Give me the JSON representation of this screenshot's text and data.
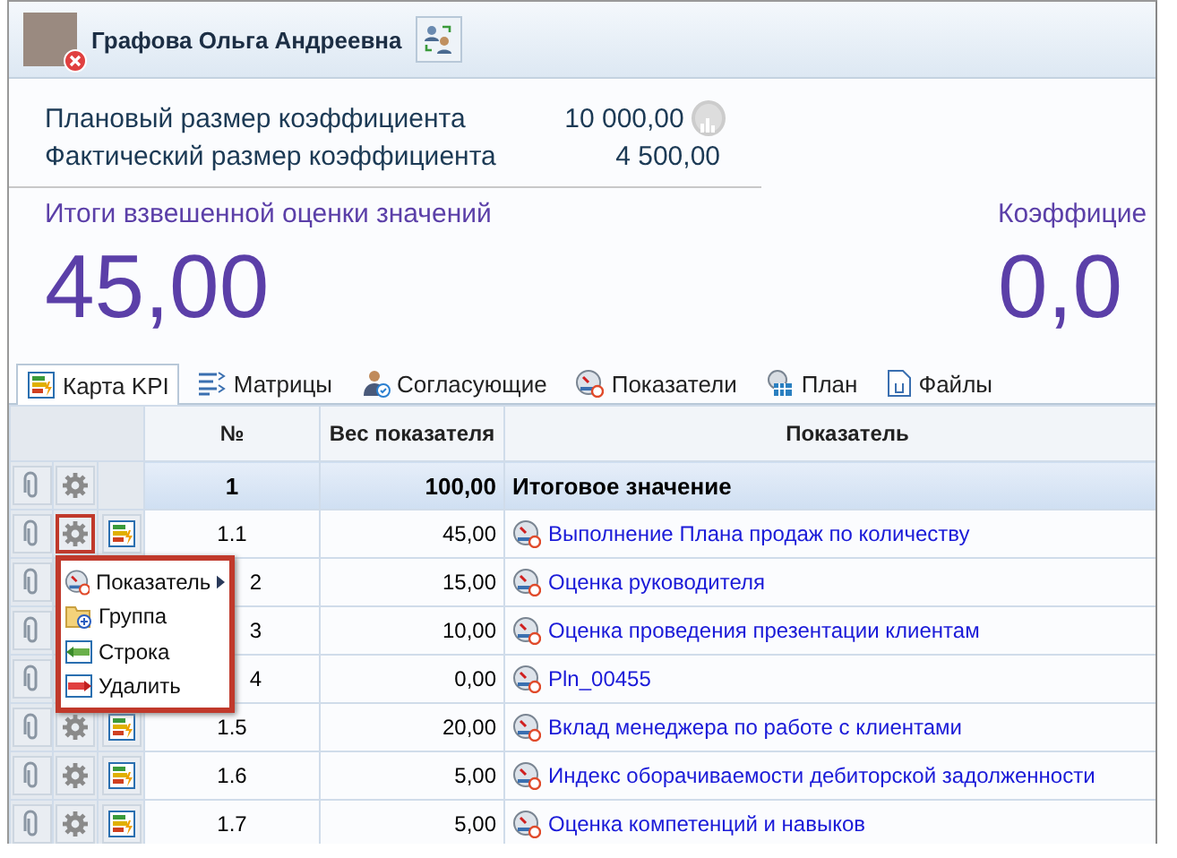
{
  "user": {
    "name": "Графова Ольга Андреевна"
  },
  "summary": [
    {
      "label": "Плановый размер коэффициента",
      "value": "10 000,00",
      "chart_button": true
    },
    {
      "label": "Фактический размер коэффициента",
      "value": "4 500,00",
      "chart_button": false
    }
  ],
  "totals": [
    {
      "label": "Итоги взвешенной оценки значений",
      "value": "45,00"
    },
    {
      "label": "Коэффицие",
      "value": "0,0"
    }
  ],
  "tabs": [
    {
      "label": "Карта KPI",
      "kind": "map",
      "selected": true
    },
    {
      "label": "Матрицы",
      "kind": "matrix",
      "selected": false
    },
    {
      "label": "Согласующие",
      "kind": "approvers",
      "selected": false
    },
    {
      "label": "Показатели",
      "kind": "gauge",
      "selected": false
    },
    {
      "label": "План",
      "kind": "plan",
      "selected": false
    },
    {
      "label": "Файлы",
      "kind": "files",
      "selected": false
    }
  ],
  "table": {
    "columns": [
      "№",
      "Вес показателя",
      "Показатель"
    ],
    "rows": [
      {
        "kind": "total",
        "number": "1",
        "weight": "100,00",
        "name": "Итоговое значение",
        "menu_open": false,
        "partly_hidden": false
      },
      {
        "kind": "item",
        "number": "1.1",
        "weight": "45,00",
        "name": "Выполнение Плана продаж по количеству",
        "menu_open": true,
        "partly_hidden": false
      },
      {
        "kind": "item",
        "number": "2",
        "weight": "15,00",
        "name": "Оценка руководителя",
        "menu_open": false,
        "partly_hidden": true
      },
      {
        "kind": "item",
        "number": "3",
        "weight": "10,00",
        "name": "Оценка проведения презентации клиентам",
        "menu_open": false,
        "partly_hidden": true
      },
      {
        "kind": "item",
        "number": "4",
        "weight": "0,00",
        "name": "Pln_00455",
        "menu_open": false,
        "partly_hidden": true
      },
      {
        "kind": "item",
        "number": "1.5",
        "weight": "20,00",
        "name": "Вклад менеджера по работе с клиентами",
        "menu_open": false,
        "partly_hidden": false
      },
      {
        "kind": "item",
        "number": "1.6",
        "weight": "5,00",
        "name": "Индекс оборачиваемости дебиторской задолженности",
        "menu_open": false,
        "partly_hidden": false
      },
      {
        "kind": "item",
        "number": "1.7",
        "weight": "5,00",
        "name": "Оценка компетенций и навыков",
        "menu_open": false,
        "partly_hidden": false
      }
    ]
  },
  "context_menu": {
    "items": [
      {
        "label": "Показатель",
        "kind": "indicator",
        "submenu": true
      },
      {
        "label": "Группа",
        "kind": "group",
        "submenu": false
      },
      {
        "label": "Строка",
        "kind": "row",
        "submenu": false
      },
      {
        "label": "Удалить",
        "kind": "delete",
        "submenu": false
      }
    ]
  }
}
